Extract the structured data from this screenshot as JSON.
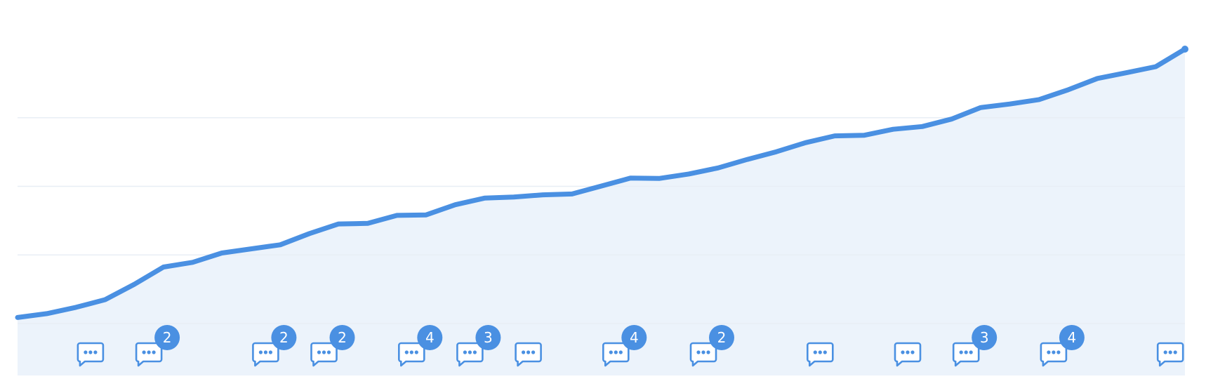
{
  "chart_data": {
    "type": "area",
    "title": "",
    "xlabel": "",
    "ylabel": "",
    "grid": true,
    "legend": "none",
    "colors": {
      "line": "#4a90e2",
      "area": "#ecf3fb",
      "grid": "#e8eef5",
      "badge": "#4a90e2",
      "badge_text": "#ffffff"
    },
    "ylim": [
      0,
      100
    ],
    "grid_values": [
      25,
      50,
      75
    ],
    "series": [
      {
        "values": [
          2.2,
          3.6,
          5.9,
          8.7,
          14.3,
          20.6,
          22.3,
          25.7,
          27.2,
          28.7,
          32.8,
          36.3,
          36.5,
          39.4,
          39.6,
          43.3,
          45.7,
          46.1,
          46.9,
          47.2,
          50.1,
          53.0,
          52.9,
          54.5,
          56.7,
          59.8,
          62.6,
          65.9,
          68.4,
          68.6,
          70.8,
          71.8,
          74.5,
          78.7,
          80.0,
          81.6,
          85.2,
          89.3,
          91.4,
          93.6,
          100.0
        ]
      }
    ],
    "annotations": [
      {
        "index": 2.5,
        "count": null
      },
      {
        "index": 4.5,
        "count": 2
      },
      {
        "index": 8.5,
        "count": 2
      },
      {
        "index": 10.5,
        "count": 2
      },
      {
        "index": 13.5,
        "count": 4
      },
      {
        "index": 15.5,
        "count": 3
      },
      {
        "index": 17.5,
        "count": null
      },
      {
        "index": 20.5,
        "count": 4
      },
      {
        "index": 23.5,
        "count": 2
      },
      {
        "index": 27.5,
        "count": null
      },
      {
        "index": 30.5,
        "count": null
      },
      {
        "index": 32.5,
        "count": 3
      },
      {
        "index": 35.5,
        "count": 4
      },
      {
        "index": 39.5,
        "count": null
      }
    ]
  }
}
